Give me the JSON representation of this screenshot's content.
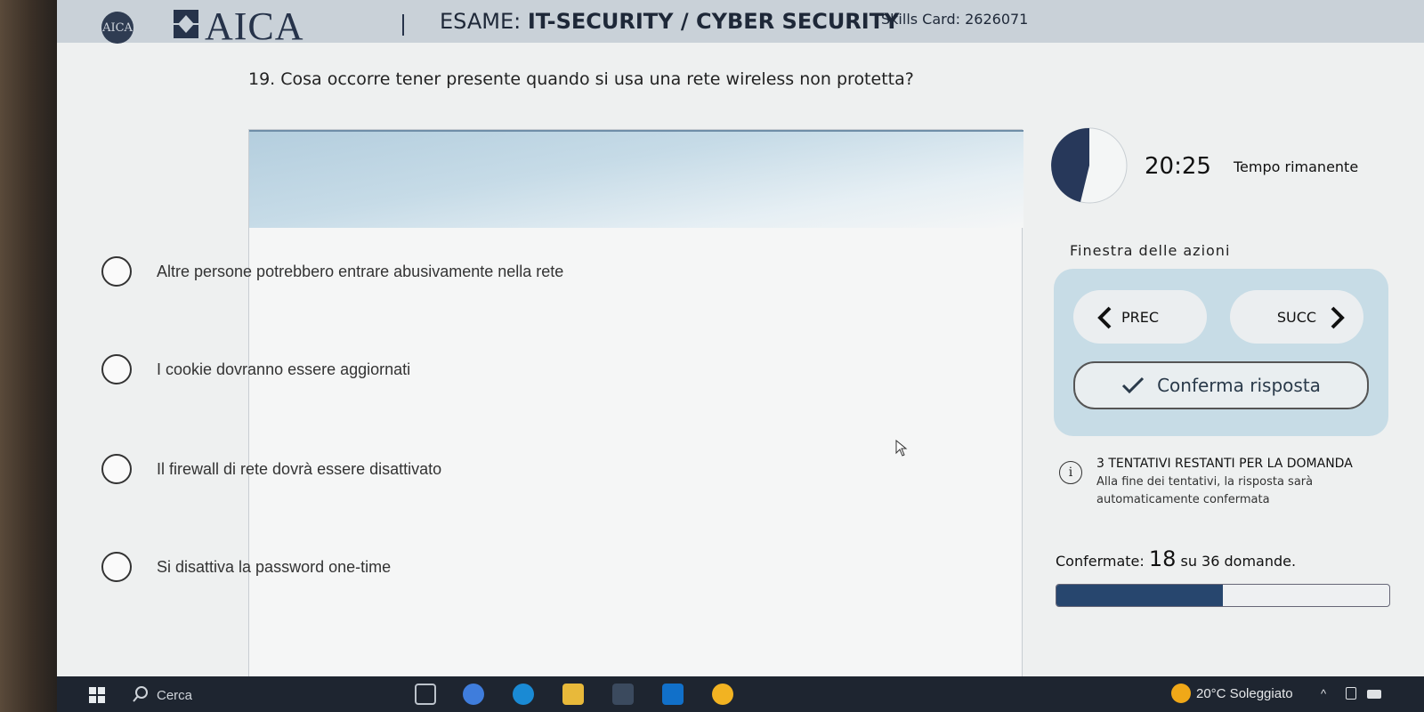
{
  "header": {
    "small_logo": "AICA",
    "brand": "AICA",
    "exam_prefix": "ESAME: ",
    "exam_title": "IT-SECURITY / CYBER SECURITY",
    "skills_card_label": "Skills Card: ",
    "skills_card_number": "2626071"
  },
  "question": {
    "text": "19. Cosa occorre tener presente quando si usa una rete wireless non protetta?"
  },
  "answers": [
    {
      "label": "Altre persone potrebbero entrare abusivamente nella rete"
    },
    {
      "label": "I cookie dovranno essere aggiornati"
    },
    {
      "label": "Il firewall di rete dovrà essere disattivato"
    },
    {
      "label": "Si disattiva la password one-time"
    }
  ],
  "timer": {
    "value": "20:25",
    "label": "Tempo rimanente"
  },
  "actions": {
    "title": "Finestra delle azioni",
    "prev_label": "PREC",
    "next_label": "SUCC",
    "confirm_label": "Conferma risposta"
  },
  "attempts": {
    "title": "3 TENTATIVI RESTANTI PER LA DOMANDA",
    "note": "Alla fine dei tentativi, la risposta sarà automaticamente confermata"
  },
  "progress": {
    "prefix": "Confermate: ",
    "confirmed": "18",
    "suffix": " su 36 domande.",
    "fraction": 0.5
  },
  "taskbar": {
    "search_placeholder": "Cerca",
    "weather": "20°C  Soleggiato"
  },
  "colors": {
    "accent_dark": "#26334a",
    "progress_fill": "#27466e",
    "actions_bg": "#c7dce6"
  }
}
